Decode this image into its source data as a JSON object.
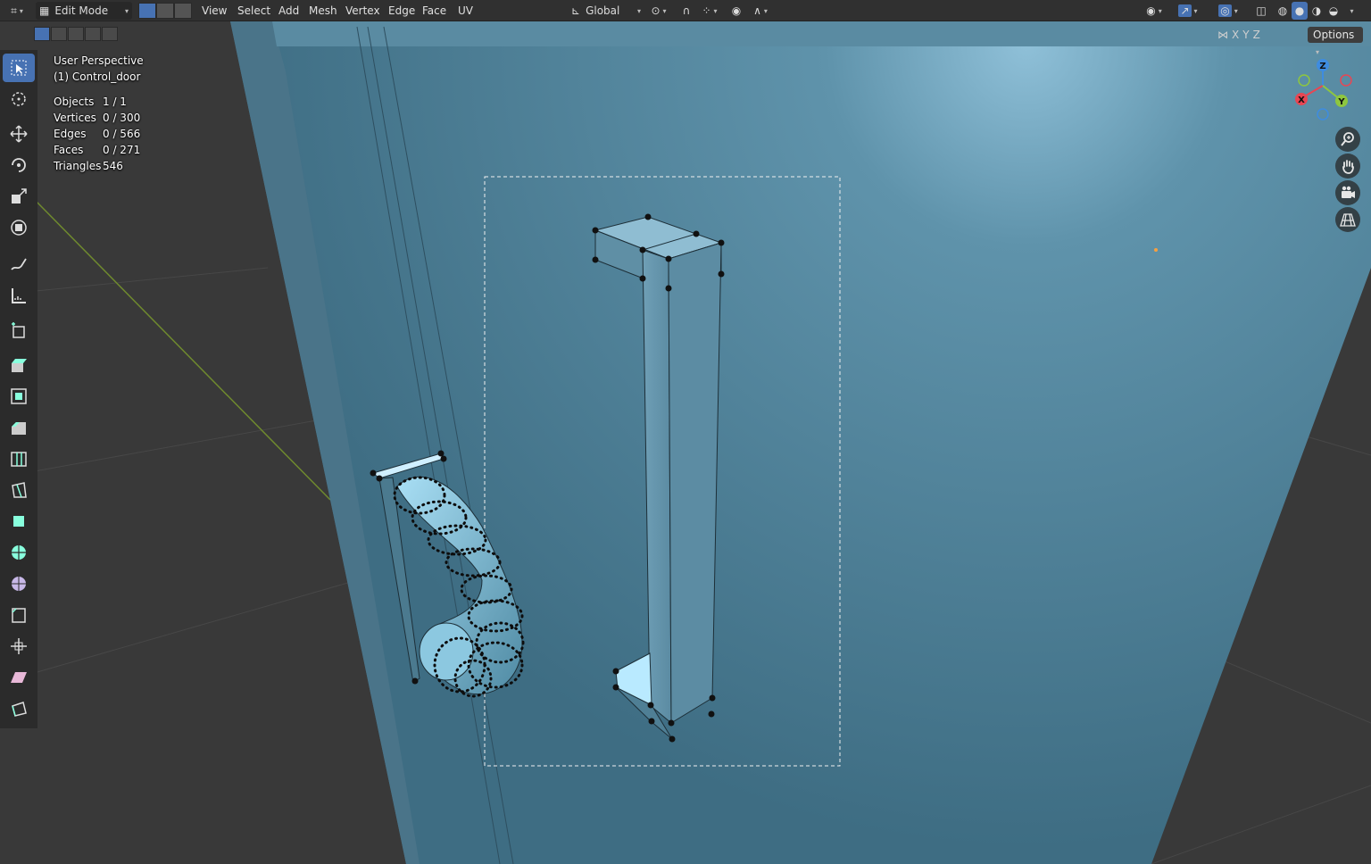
{
  "header": {
    "mode": "Edit Mode",
    "menus": [
      "View",
      "Select",
      "Add",
      "Mesh",
      "Vertex",
      "Edge",
      "Face",
      "UV"
    ],
    "transform_orientation": "Global",
    "options_label": "Options",
    "axes": [
      "X",
      "Y",
      "Z"
    ]
  },
  "overlay": {
    "view_name": "User Perspective",
    "object_name": "(1) Control_door",
    "stats": [
      {
        "label": "Objects",
        "value": "1 / 1"
      },
      {
        "label": "Vertices",
        "value": "0 / 300"
      },
      {
        "label": "Edges",
        "value": "0 / 566"
      },
      {
        "label": "Faces",
        "value": "0 / 271"
      },
      {
        "label": "Triangles",
        "value": "546"
      }
    ]
  },
  "gizmo": {
    "x": "X",
    "y": "Y",
    "z": "Z"
  },
  "toolbar": {
    "tools": [
      "select-box-icon",
      "cursor-icon",
      "move-icon",
      "rotate-icon",
      "scale-icon",
      "transform-icon",
      "annotate-icon",
      "measure-icon",
      "add-cube-icon",
      "extrude-icon",
      "inset-icon",
      "bevel-icon",
      "loop-cut-icon",
      "knife-icon",
      "poly-build-icon",
      "spin-icon",
      "smooth-icon",
      "edge-slide-icon",
      "shrink-fatten-icon",
      "shear-icon",
      "rip-icon"
    ]
  },
  "colors": {
    "accent": "#4772b3",
    "header_bg": "#303030",
    "viewport_grid": "#393939",
    "door_blue": "#5b8ca4",
    "x_axis": "#e84653",
    "y_axis": "#8ec63f",
    "z_axis": "#3e8ce0"
  }
}
